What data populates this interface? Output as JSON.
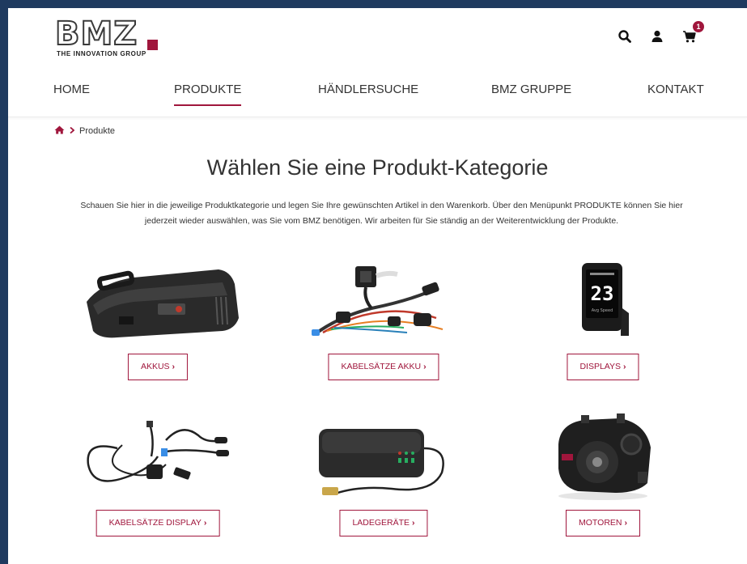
{
  "logo": {
    "letters": "BMZ",
    "tagline": "THE INNOVATION GROUP"
  },
  "cart": {
    "badge": "1"
  },
  "nav": [
    {
      "label": "HOME"
    },
    {
      "label": "PRODUKTE"
    },
    {
      "label": "HÄNDLERSUCHE"
    },
    {
      "label": "BMZ GRUPPE"
    },
    {
      "label": "KONTAKT"
    }
  ],
  "breadcrumb": {
    "current": "Produkte"
  },
  "title": "Wählen Sie eine Produkt-Kategorie",
  "intro": {
    "line1": "Schauen Sie hier in die jeweilige Produktkategorie und legen Sie Ihre gewünschten Artikel in den Warenkorb. Über den Menüpunkt PRODUKTE können Sie hier",
    "line2": "jederzeit wieder auswählen, was Sie vom BMZ benötigen. Wir arbeiten für Sie ständig an der Weiterentwicklung der Produkte."
  },
  "products": [
    {
      "label": "AKKUS",
      "chevron": "›"
    },
    {
      "label": "KABELSÄTZE AKKU",
      "chevron": "›"
    },
    {
      "label": "DISPLAYS",
      "chevron": "›"
    },
    {
      "label": "KABELSÄTZE DISPLAY",
      "chevron": "›"
    },
    {
      "label": "LADEGERÄTE",
      "chevron": "›"
    },
    {
      "label": "MOTOREN",
      "chevron": "›"
    }
  ],
  "display_screen": {
    "speed": "23",
    "caption": "Avg Speed"
  },
  "colors": {
    "accent": "#a0163c",
    "frame": "#1f3a5f",
    "text": "#333333"
  }
}
